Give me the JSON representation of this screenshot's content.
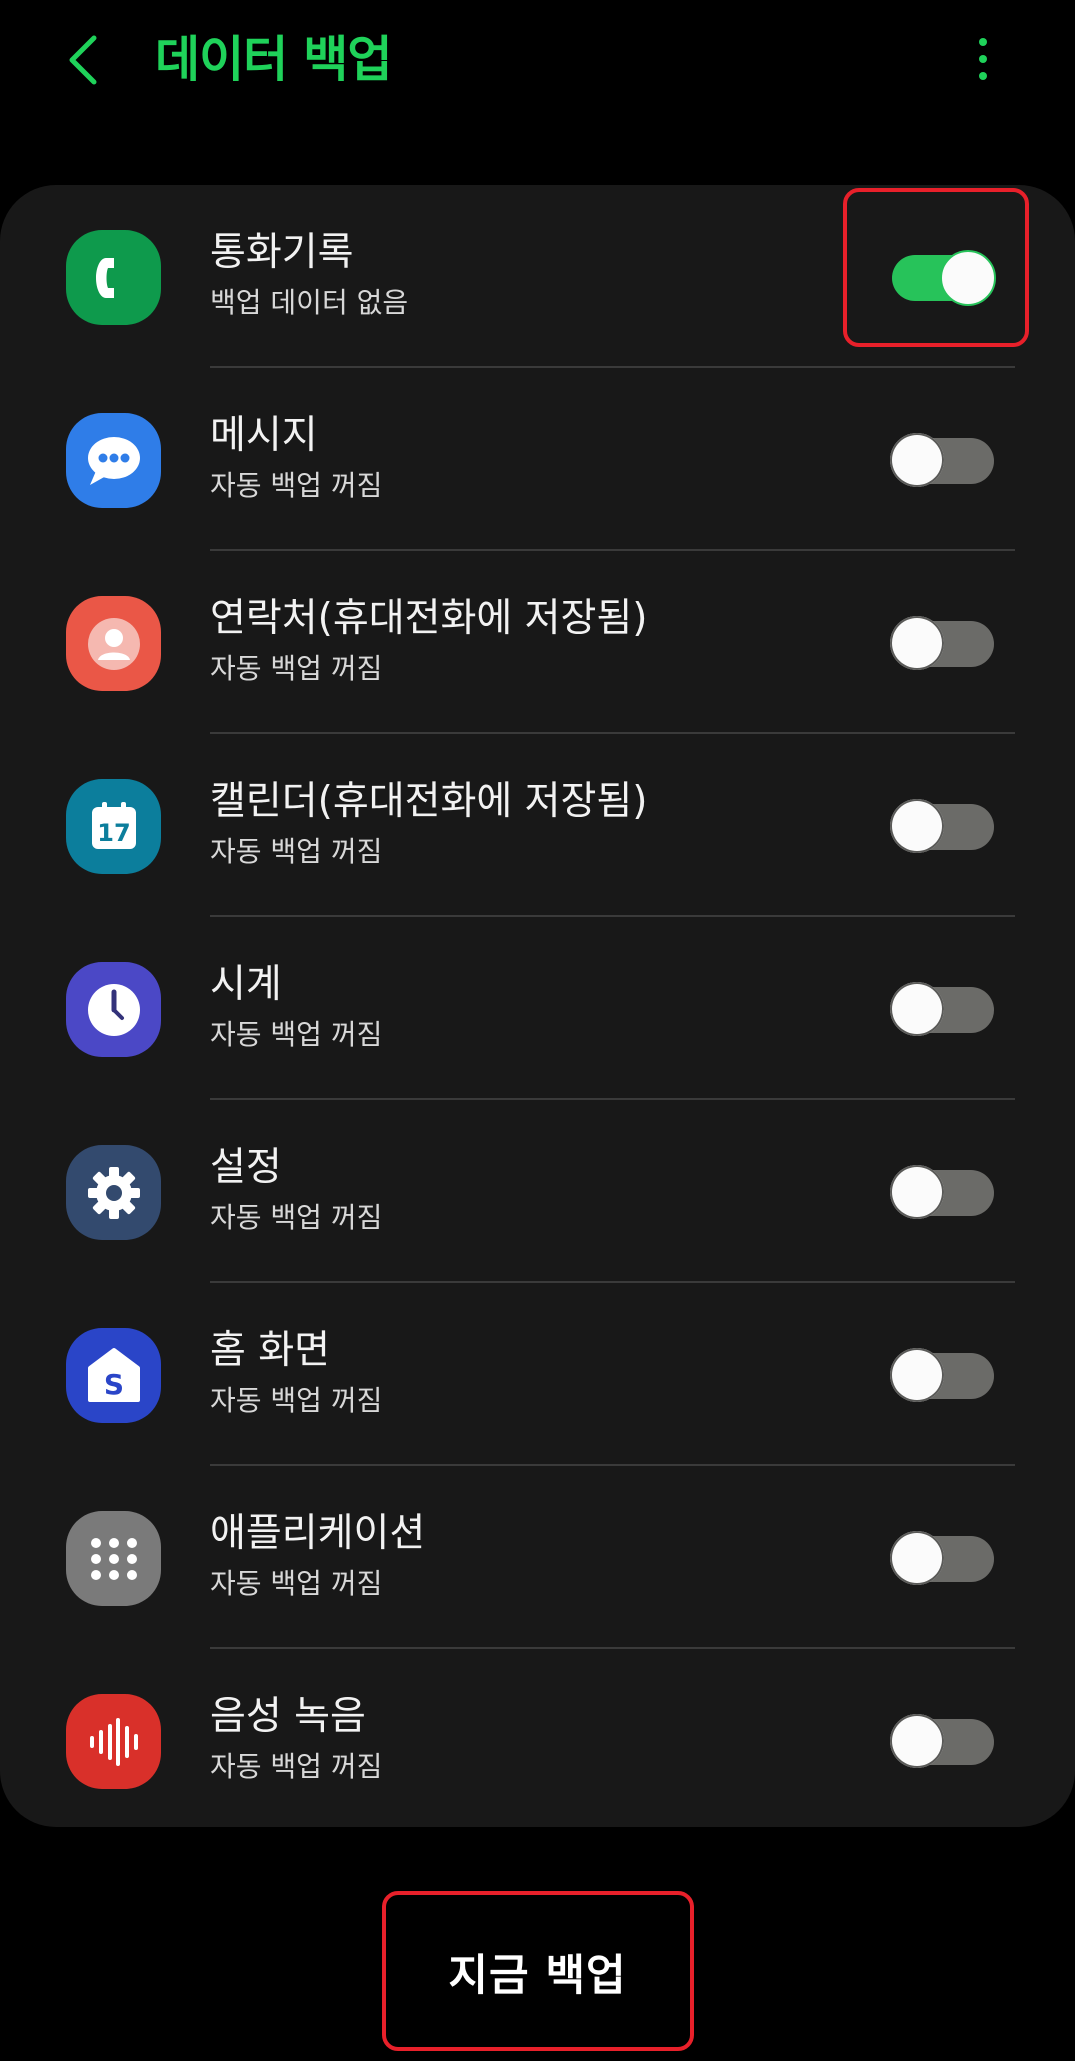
{
  "header": {
    "title": "데이터 백업",
    "back_icon": "chevron-left-icon",
    "more_icon": "more-vertical-icon",
    "accent_color": "#1fd25a"
  },
  "items": [
    {
      "title": "통화기록",
      "subtitle": "백업 데이터 없음",
      "enabled": true,
      "icon": "phone-icon",
      "icon_color": "#0e9a4c"
    },
    {
      "title": "메시지",
      "subtitle": "자동 백업 꺼짐",
      "enabled": false,
      "icon": "message-icon",
      "icon_color": "#2f7de8"
    },
    {
      "title": "연락처(휴대전화에 저장됨)",
      "subtitle": "자동 백업 꺼짐",
      "enabled": false,
      "icon": "contacts-icon",
      "icon_color": "#ea5747"
    },
    {
      "title": "캘린더(휴대전화에 저장됨)",
      "subtitle": "자동 백업 꺼짐",
      "enabled": false,
      "icon": "calendar-icon",
      "icon_color": "#0c7e9c",
      "icon_text": "17"
    },
    {
      "title": "시계",
      "subtitle": "자동 백업 꺼짐",
      "enabled": false,
      "icon": "clock-icon",
      "icon_color": "#4b48c6"
    },
    {
      "title": "설정",
      "subtitle": "자동 백업 꺼짐",
      "enabled": false,
      "icon": "gear-icon",
      "icon_color": "#334a6e"
    },
    {
      "title": "홈 화면",
      "subtitle": "자동 백업 꺼짐",
      "enabled": false,
      "icon": "home-icon",
      "icon_color": "#2a45c8",
      "icon_text": "S"
    },
    {
      "title": "애플리케이션",
      "subtitle": "자동 백업 꺼짐",
      "enabled": false,
      "icon": "apps-grid-icon",
      "icon_color": "#7a7a7a"
    },
    {
      "title": "음성 녹음",
      "subtitle": "자동 백업 꺼짐",
      "enabled": false,
      "icon": "voice-recorder-icon",
      "icon_color": "#d9302a"
    }
  ],
  "backup_button": {
    "label": "지금 백업"
  },
  "highlight_color": "#e8202a"
}
